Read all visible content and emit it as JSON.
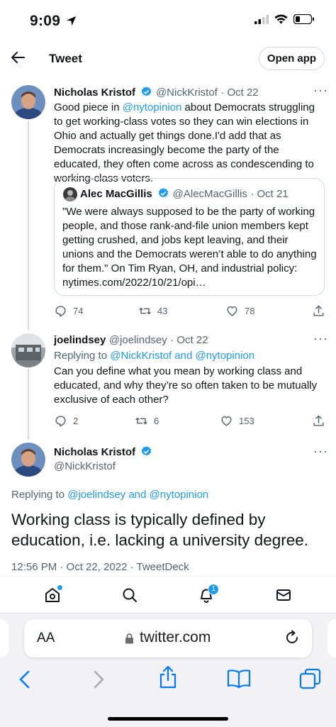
{
  "status": {
    "time": "9:09"
  },
  "header": {
    "title": "Tweet",
    "open_app": "Open app"
  },
  "tweets": [
    {
      "name": "Nicholas Kristof",
      "handle": "@NickKristof",
      "date": "· Oct 22",
      "text_pre": "Good piece in ",
      "text_link": "@nytopinion",
      "text_post": " about Democrats struggling to get working-class votes so they can win elections in Ohio and actually get things done.I'd add that as Democrats increasingly become the party of the educated, they often come across as condescending to working-class voters.",
      "quote": {
        "name": "Alec MacGillis",
        "handle": "@AlecMacGillis",
        "date": "· Oct 21",
        "text": "\"We were always supposed to be the party of working people, and those rank-and-file union members kept getting crushed, and jobs kept leaving, and their unions and the Democrats weren’t able to do anything for them.\" On Tim Ryan, OH, and industrial policy: nytimes.com/2022/10/21/opi…"
      },
      "replies": "74",
      "retweets": "43",
      "likes": "78"
    },
    {
      "name": "joelindsey",
      "handle": "@joelindsey",
      "date": "· Oct 22",
      "replying_prefix": "Replying to ",
      "replying_to": "@NickKristof and @nytopinion",
      "text": "Can you define what you mean by working class and educated, and why they’re so often taken to be mutually exclusive of each other?",
      "replies": "2",
      "retweets": "6",
      "likes": "153"
    }
  ],
  "main_tweet": {
    "name": "Nicholas Kristof",
    "handle": "@NickKristof",
    "replying_prefix": "Replying to ",
    "replying_to": "@joelindsey and @nytopinion",
    "text": "Working class is typically defined by education, i.e. lacking a university degree.",
    "meta": "12:56 PM · Oct 22, 2022 · TweetDeck"
  },
  "nav": {
    "notification_count": "1"
  },
  "safari": {
    "aa": "AA",
    "url": "twitter.com"
  },
  "colors": {
    "accent": "#1d9bf0",
    "muted": "#536471",
    "safari_blue": "#007aff"
  }
}
